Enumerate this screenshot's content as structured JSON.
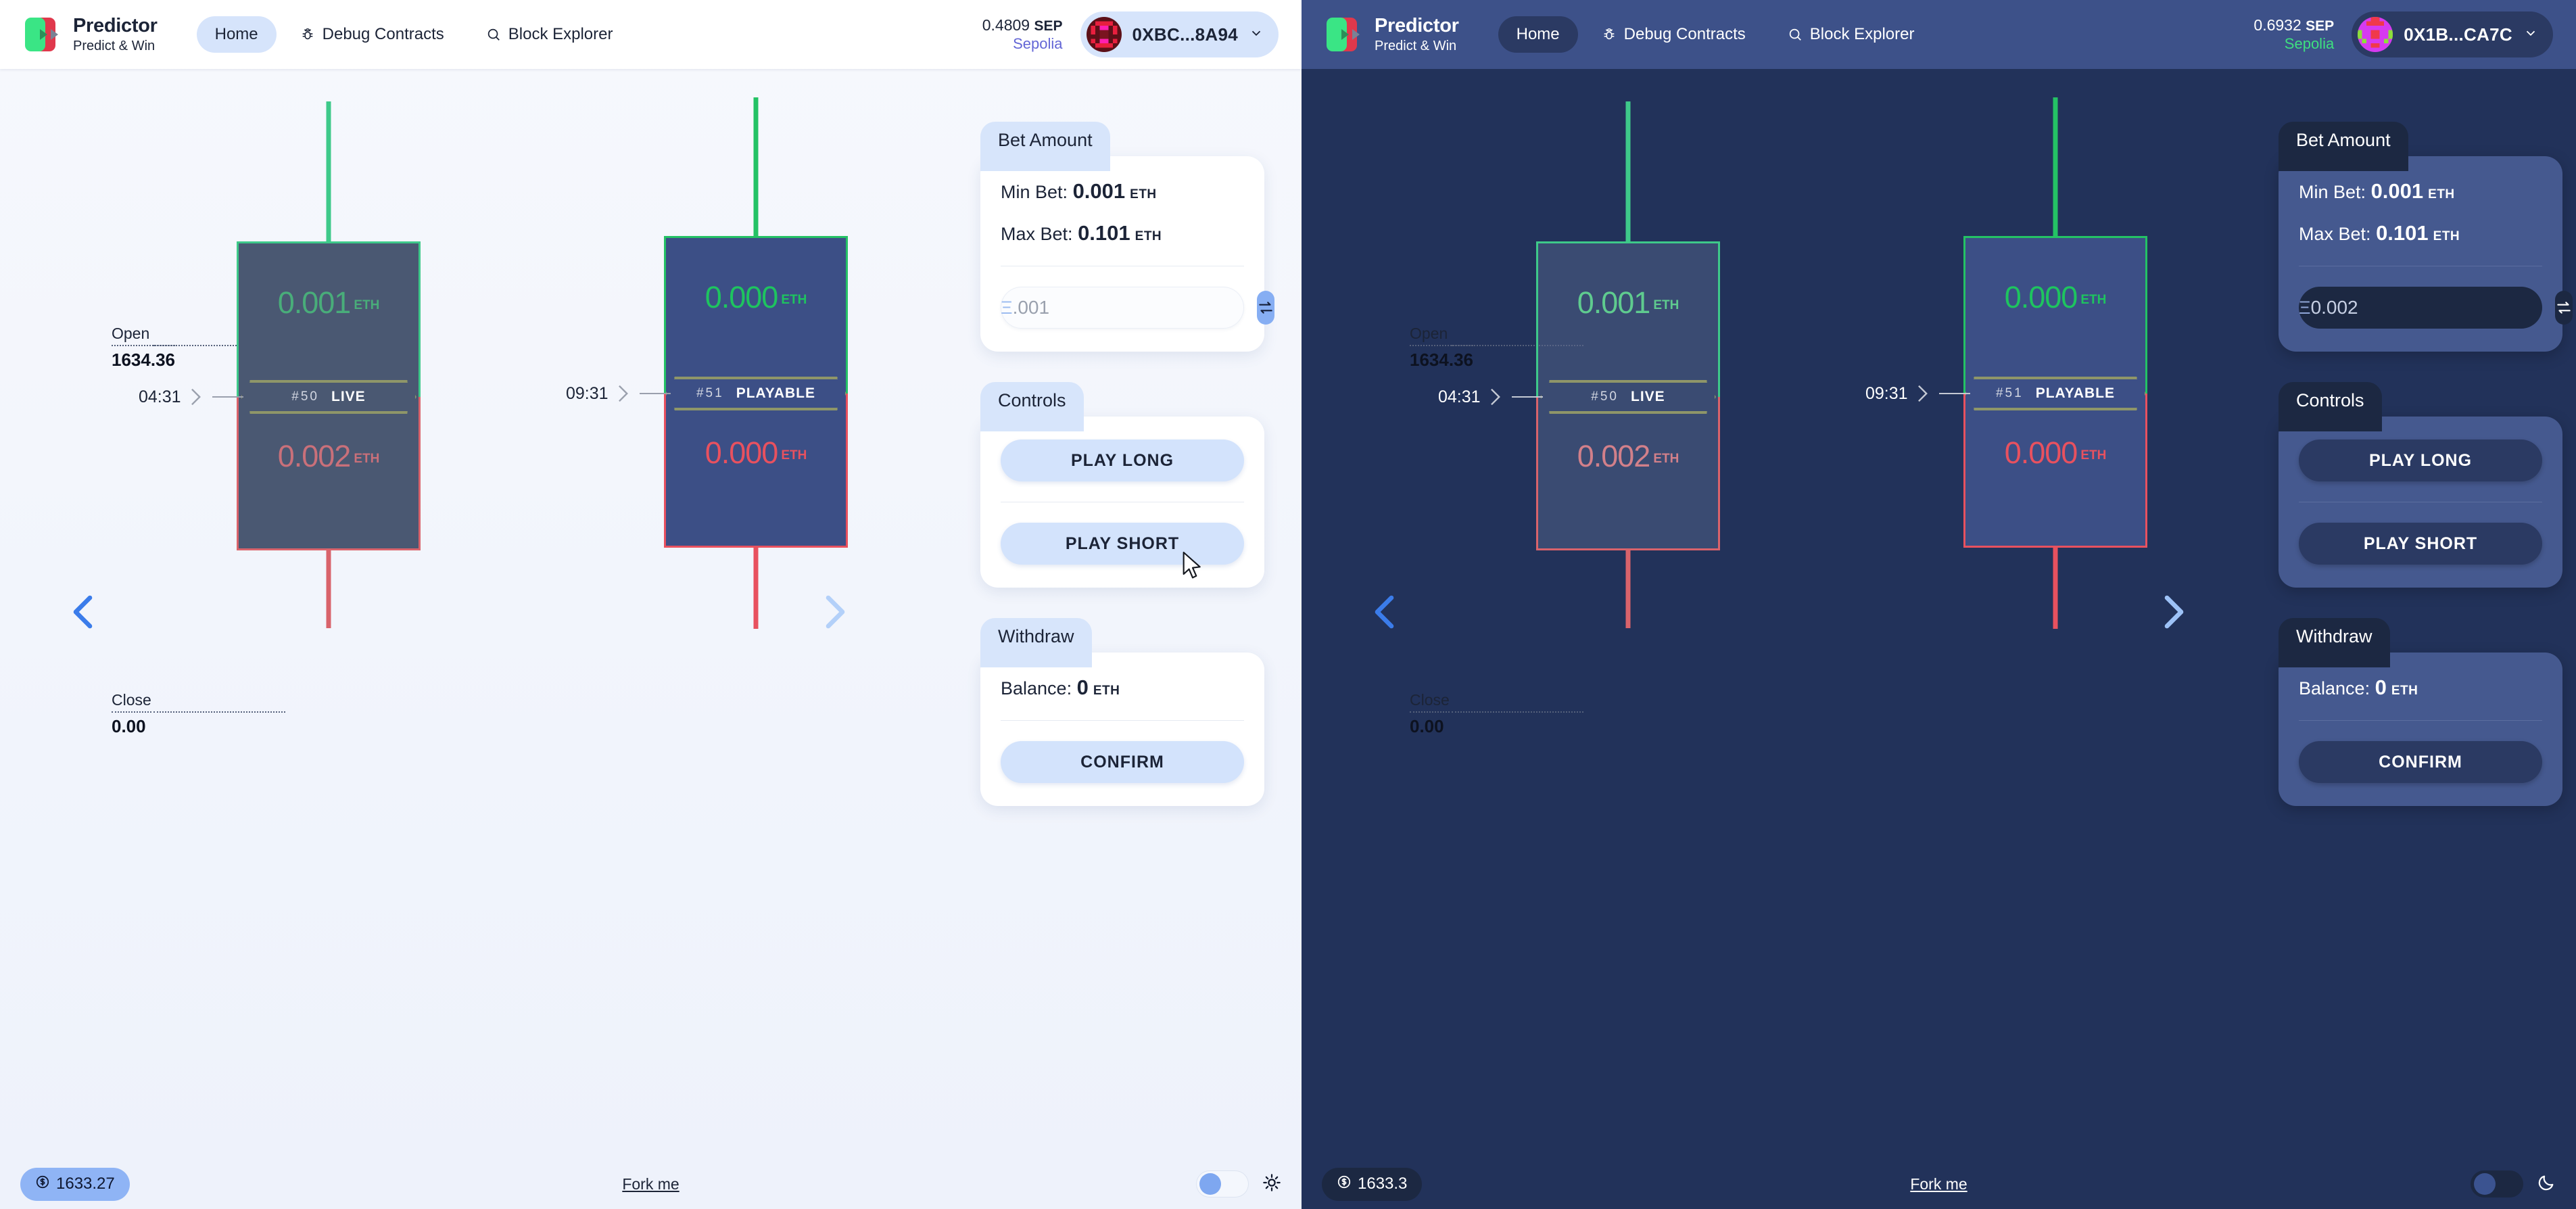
{
  "brand": {
    "name": "Predictor",
    "tagline": "Predict & Win",
    "logo_green": "#3ae585",
    "logo_red": "#e0384c"
  },
  "nav": {
    "items": [
      {
        "label": "Home",
        "icon": "home-icon",
        "active": true
      },
      {
        "label": "Debug Contracts",
        "icon": "bug-icon",
        "active": false
      },
      {
        "label": "Block Explorer",
        "icon": "search-icon",
        "active": false
      }
    ]
  },
  "light": {
    "balance_amount": "0.4809",
    "balance_symbol": "SEP",
    "network": "Sepolia",
    "account": "0XBC...8A94",
    "bet": {
      "tab": "Bet Amount",
      "min_label": "Min Bet:",
      "min_value": "0.001",
      "max_label": "Max Bet:",
      "max_value": "0.101",
      "unit": "ETH",
      "input_value": "",
      "input_placeholder": ".001"
    },
    "controls": {
      "tab": "Controls",
      "play_long": "PLAY LONG",
      "play_short": "PLAY SHORT"
    },
    "withdraw": {
      "tab": "Withdraw",
      "balance_label": "Balance:",
      "balance_value": "0",
      "unit": "ETH",
      "confirm": "CONFIRM"
    },
    "footer": {
      "price": "1633.27",
      "fork": "Fork me",
      "theme_icon": "sun-icon"
    }
  },
  "dark": {
    "balance_amount": "0.6932",
    "balance_symbol": "SEP",
    "network": "Sepolia",
    "account": "0X1B...CA7C",
    "bet": {
      "tab": "Bet Amount",
      "min_label": "Min Bet:",
      "min_value": "0.001",
      "max_label": "Max Bet:",
      "max_value": "0.101",
      "unit": "ETH",
      "input_value": "0.002",
      "input_placeholder": ".001"
    },
    "controls": {
      "tab": "Controls",
      "play_long": "PLAY LONG",
      "play_short": "PLAY SHORT"
    },
    "withdraw": {
      "tab": "Withdraw",
      "balance_label": "Balance:",
      "balance_value": "0",
      "unit": "ETH",
      "confirm": "CONFIRM"
    },
    "footer": {
      "price": "1633.3",
      "fork": "Fork me",
      "theme_icon": "moon-icon"
    }
  },
  "chart_data": {
    "type": "candlestick",
    "open_label": "Open",
    "open_value": "1634.36",
    "close_label": "Close",
    "close_value": "0.00",
    "candles": [
      {
        "id": "#50",
        "status": "LIVE",
        "timer": "04:31",
        "long_amount": "0.001",
        "short_amount": "0.002",
        "unit": "ETH"
      },
      {
        "id": "#51",
        "status": "PLAYABLE",
        "timer": "09:31",
        "long_amount": "0.000",
        "short_amount": "0.000",
        "unit": "ETH"
      }
    ]
  }
}
